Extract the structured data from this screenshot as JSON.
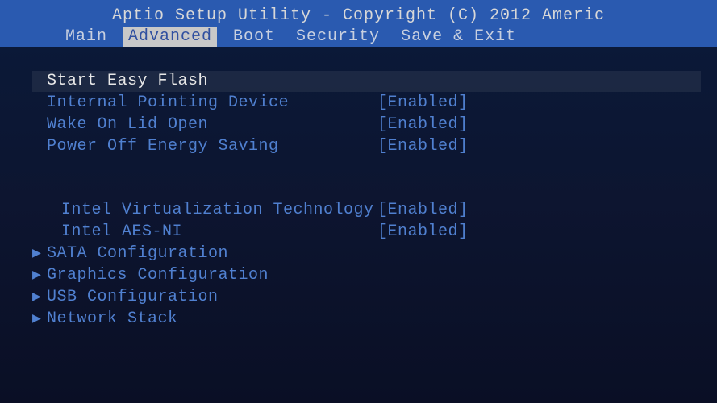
{
  "header": {
    "title": "Aptio Setup Utility - Copyright (C) 2012 Americ",
    "tabs": [
      {
        "label": "Main",
        "active": false
      },
      {
        "label": "Advanced",
        "active": true
      },
      {
        "label": "Boot",
        "active": false
      },
      {
        "label": "Security",
        "active": false
      },
      {
        "label": "Save & Exit",
        "active": false
      }
    ]
  },
  "content": {
    "group1": [
      {
        "label": "Start Easy Flash",
        "value": null,
        "submenu": false,
        "highlighted": true
      },
      {
        "label": "Internal Pointing Device",
        "value": "[Enabled]",
        "submenu": false,
        "highlighted": false
      },
      {
        "label": "Wake On Lid Open",
        "value": "[Enabled]",
        "submenu": false,
        "highlighted": false
      },
      {
        "label": "Power Off Energy Saving",
        "value": "[Enabled]",
        "submenu": false,
        "highlighted": false
      }
    ],
    "group2": [
      {
        "label": "Intel Virtualization Technology",
        "value": "[Enabled]",
        "submenu": false,
        "highlighted": false,
        "indent": true
      },
      {
        "label": "Intel AES-NI",
        "value": "[Enabled]",
        "submenu": false,
        "highlighted": false,
        "indent": true
      },
      {
        "label": "SATA Configuration",
        "value": null,
        "submenu": true,
        "highlighted": false
      },
      {
        "label": "Graphics Configuration",
        "value": null,
        "submenu": true,
        "highlighted": false
      },
      {
        "label": "USB Configuration",
        "value": null,
        "submenu": true,
        "highlighted": false
      },
      {
        "label": "Network Stack",
        "value": null,
        "submenu": true,
        "highlighted": false
      }
    ]
  }
}
